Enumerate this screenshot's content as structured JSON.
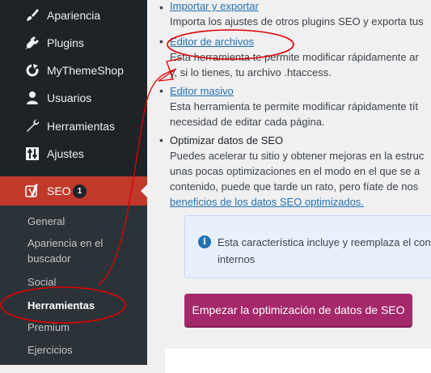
{
  "sidebar": {
    "items": [
      {
        "label": "Apariencia",
        "icon": "paintbrush-icon"
      },
      {
        "label": "Plugins",
        "icon": "plugin-icon"
      },
      {
        "label": "MyThemeShop",
        "icon": "refresh-icon"
      },
      {
        "label": "Usuarios",
        "icon": "user-icon"
      },
      {
        "label": "Herramientas",
        "icon": "wrench-icon"
      },
      {
        "label": "Ajustes",
        "icon": "settings-sliders-icon"
      }
    ],
    "seo": {
      "label": "SEO",
      "badge": "1",
      "icon": "yoast-icon"
    },
    "submenu": [
      {
        "label": "General"
      },
      {
        "label": "Apariencia en el buscador"
      },
      {
        "label": "Social"
      },
      {
        "label": "Herramientas",
        "active": true
      },
      {
        "label": "Premium"
      },
      {
        "label": "Ejercicios"
      }
    ]
  },
  "content": {
    "tools": [
      {
        "title": "Importar y exportar",
        "desc": [
          "Importa los ajustes de otros plugins SEO y exporta tus"
        ]
      },
      {
        "title": "Editor de archivos",
        "desc": [
          "Esta herramienta te permite modificar rápidamente ar",
          "y, si lo tienes, tu archivo .htaccess."
        ]
      },
      {
        "title": "Editor masivo",
        "desc": [
          "Esta herramienta te permite modificar rápidamente tít",
          "necesidad de editar cada página."
        ]
      },
      {
        "title": "Optimizar datos de SEO",
        "desc": [
          "Puedes acelerar tu sitio y obtener mejoras en la estruc",
          "unas pocas optimizaciones en el modo en el que se a",
          "contenido, puede que tarde un rato, pero fíate de nos"
        ],
        "link": "beneficios de los datos SEO optimizados."
      }
    ],
    "notice": {
      "line1": "Esta característica incluye y reemplaza el conta",
      "line2": "internos",
      "icon": "info-icon"
    },
    "button": "Empezar la optimización de datos de SEO"
  },
  "colors": {
    "sidebar": "#1d2327",
    "seo_active": "#c0392b",
    "link": "#2271b1",
    "button": "#a4286a",
    "annotation": "#e00000"
  }
}
